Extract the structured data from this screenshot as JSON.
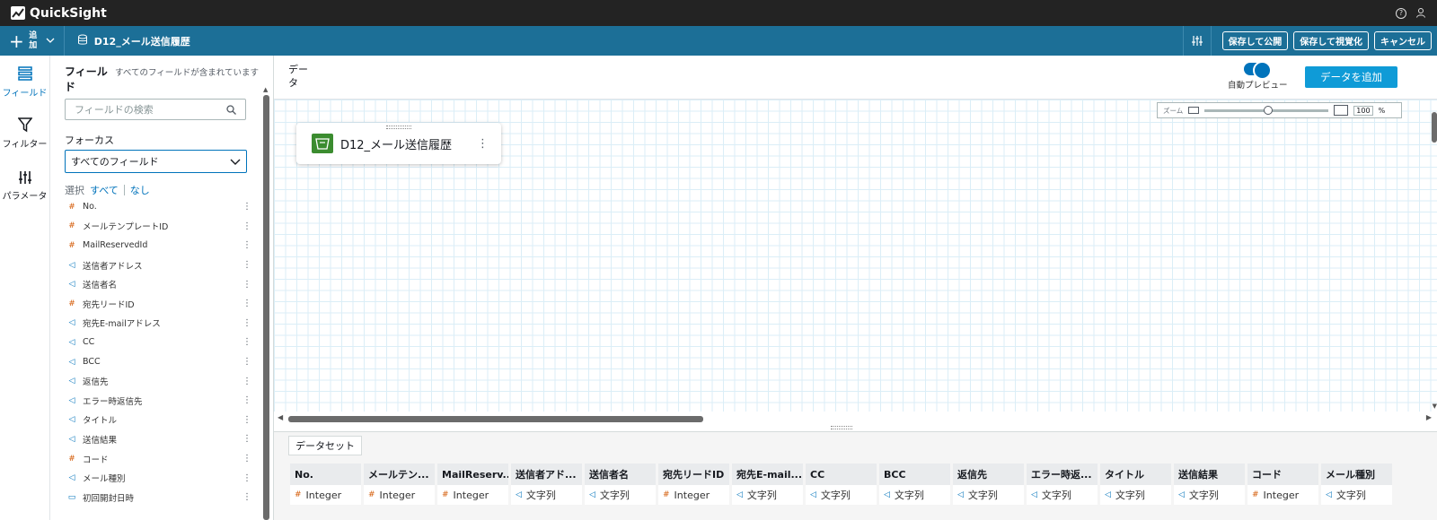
{
  "app": {
    "name": "QuickSight"
  },
  "toolbar": {
    "add_label": "追加",
    "dataset_name": "D12_メール送信履歴",
    "publish_label": "保存して公開",
    "visualize_label": "保存して視覚化",
    "cancel_label": "キャンセル"
  },
  "nav": {
    "fields": "フィールド",
    "filter": "フィルター",
    "params": "パラメータ"
  },
  "fields_panel": {
    "title": "フィールド",
    "subtitle": "すべてのフィールドが含まれています",
    "search_placeholder": "フィールドの検索",
    "focus_label": "フォーカス",
    "focus_value": "すべてのフィールド",
    "select_label": "選択",
    "select_all": "すべて",
    "select_none": "なし",
    "fields": [
      {
        "name": "No.",
        "type": "number"
      },
      {
        "name": "メールテンプレートID",
        "type": "number"
      },
      {
        "name": "MailReservedId",
        "type": "number"
      },
      {
        "name": "送信者アドレス",
        "type": "string"
      },
      {
        "name": "送信者名",
        "type": "string"
      },
      {
        "name": "宛先リードID",
        "type": "number"
      },
      {
        "name": "宛先E-mailアドレス",
        "type": "string"
      },
      {
        "name": "CC",
        "type": "string"
      },
      {
        "name": "BCC",
        "type": "string"
      },
      {
        "name": "返信先",
        "type": "string"
      },
      {
        "name": "エラー時返信先",
        "type": "string"
      },
      {
        "name": "タイトル",
        "type": "string"
      },
      {
        "name": "送信結果",
        "type": "string"
      },
      {
        "name": "コード",
        "type": "number"
      },
      {
        "name": "メール種別",
        "type": "string"
      },
      {
        "name": "初回開封日時",
        "type": "date"
      }
    ]
  },
  "main": {
    "data_label": "データ",
    "auto_preview_label": "自動プレビュー",
    "add_data_label": "データを追加",
    "zoom": {
      "label": "ズーム",
      "value": "100",
      "unit": "%",
      "level": 0.5
    },
    "node_title": "D12_メール送信履歴"
  },
  "preview": {
    "tab_label": "データセット",
    "columns": [
      {
        "header": "No.",
        "type": "Integer",
        "kind": "number"
      },
      {
        "header": "メールテン...",
        "type": "Integer",
        "kind": "number"
      },
      {
        "header": "MailReserv...",
        "type": "Integer",
        "kind": "number"
      },
      {
        "header": "送信者アド...",
        "type": "文字列",
        "kind": "string"
      },
      {
        "header": "送信者名",
        "type": "文字列",
        "kind": "string"
      },
      {
        "header": "宛先リードID",
        "type": "Integer",
        "kind": "number"
      },
      {
        "header": "宛先E-mail...",
        "type": "文字列",
        "kind": "string"
      },
      {
        "header": "CC",
        "type": "文字列",
        "kind": "string"
      },
      {
        "header": "BCC",
        "type": "文字列",
        "kind": "string"
      },
      {
        "header": "返信先",
        "type": "文字列",
        "kind": "string"
      },
      {
        "header": "エラー時返...",
        "type": "文字列",
        "kind": "string"
      },
      {
        "header": "タイトル",
        "type": "文字列",
        "kind": "string"
      },
      {
        "header": "送信結果",
        "type": "文字列",
        "kind": "string"
      },
      {
        "header": "コード",
        "type": "Integer",
        "kind": "number"
      },
      {
        "header": "メール種別",
        "type": "文字列",
        "kind": "string"
      }
    ]
  },
  "colors": {
    "topbar": "#232323",
    "brand_blue": "#1c6f97",
    "accent": "#0073bb",
    "add_button": "#0f9bd7",
    "number_icon": "#d45b07"
  }
}
